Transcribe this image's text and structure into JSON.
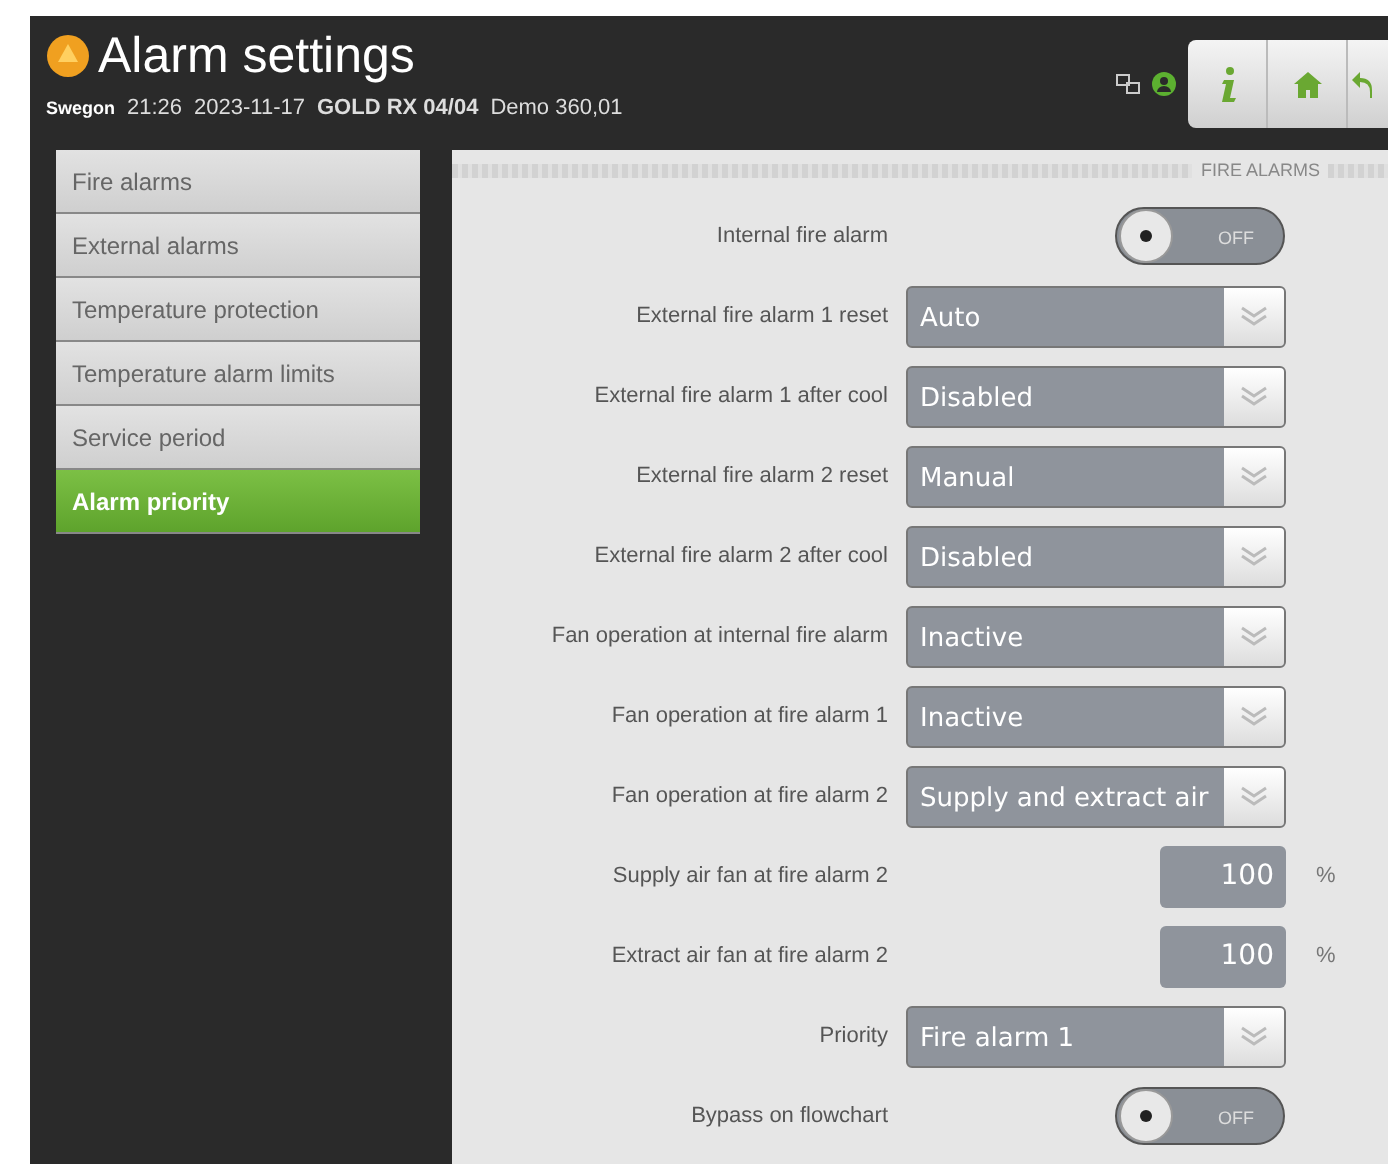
{
  "header": {
    "title": "Alarm settings",
    "brand": "Swegon",
    "time": "21:26",
    "date": "2023-11-17",
    "unit": "GOLD RX 04/04",
    "site": "Demo 360,01"
  },
  "sidebar": {
    "items": [
      {
        "label": "Fire alarms",
        "selected": false
      },
      {
        "label": "External alarms",
        "selected": false
      },
      {
        "label": "Temperature protection",
        "selected": false
      },
      {
        "label": "Temperature alarm limits",
        "selected": false
      },
      {
        "label": "Service period",
        "selected": false
      },
      {
        "label": "Alarm priority",
        "selected": true
      }
    ]
  },
  "section": {
    "title": "FIRE ALARMS"
  },
  "rows": [
    {
      "kind": "toggle",
      "label": "Internal fire alarm",
      "on": false,
      "state_text": "OFF"
    },
    {
      "kind": "select",
      "label": "External fire alarm 1 reset",
      "value": "Auto"
    },
    {
      "kind": "select",
      "label": "External fire alarm 1 after cool",
      "value": "Disabled"
    },
    {
      "kind": "select",
      "label": "External fire alarm 2 reset",
      "value": "Manual"
    },
    {
      "kind": "select",
      "label": "External fire alarm 2 after cool",
      "value": "Disabled"
    },
    {
      "kind": "select",
      "label": "Fan operation at internal fire alarm",
      "value": "Inactive"
    },
    {
      "kind": "select",
      "label": "Fan operation at fire alarm 1",
      "value": "Inactive"
    },
    {
      "kind": "select",
      "label": "Fan operation at fire alarm 2",
      "value": "Supply and extract air"
    },
    {
      "kind": "number",
      "label": "Supply air fan at fire alarm 2",
      "value": "100",
      "unit": "%"
    },
    {
      "kind": "number",
      "label": "Extract air fan at fire alarm 2",
      "value": "100",
      "unit": "%"
    },
    {
      "kind": "select",
      "label": "Priority",
      "value": "Fire alarm 1"
    },
    {
      "kind": "toggle",
      "label": "Bypass on flowchart",
      "on": false,
      "state_text": "OFF"
    }
  ]
}
